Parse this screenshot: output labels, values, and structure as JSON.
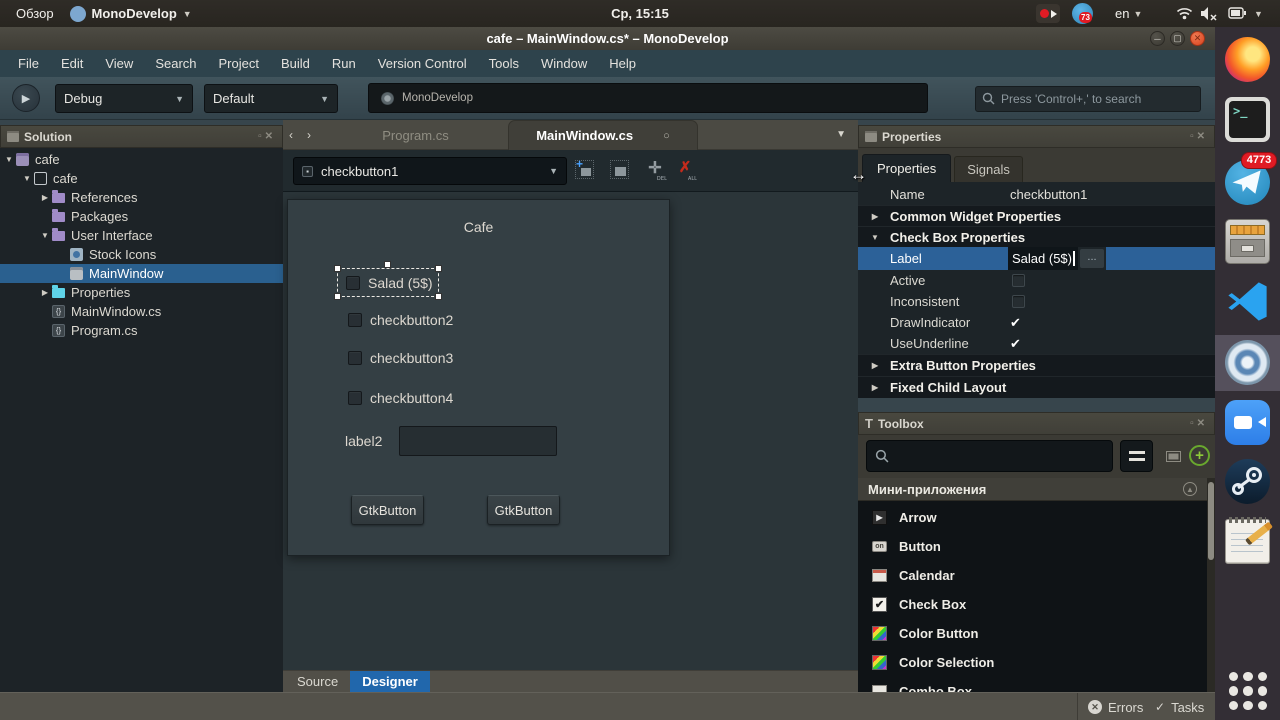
{
  "top_bar": {
    "activities": "Обзор",
    "app_indicator": "MonoDevelop",
    "clock": "Ср, 15:15",
    "language": "en",
    "tray_badge": "73"
  },
  "window": {
    "title": "cafe – MainWindow.cs* – MonoDevelop",
    "menus": [
      "File",
      "Edit",
      "View",
      "Search",
      "Project",
      "Build",
      "Run",
      "Version Control",
      "Tools",
      "Window",
      "Help"
    ],
    "toolbar": {
      "run_config": "Debug",
      "run_target": "Default",
      "status_text": "MonoDevelop",
      "search_placeholder": "Press 'Control+,' to search"
    }
  },
  "solution_pad": {
    "header": "Solution",
    "items": [
      {
        "label": "cafe"
      },
      {
        "label": "cafe"
      },
      {
        "label": "References"
      },
      {
        "label": "Packages"
      },
      {
        "label": "User Interface"
      },
      {
        "label": "Stock Icons"
      },
      {
        "label": "MainWindow"
      },
      {
        "label": "Properties"
      },
      {
        "label": "MainWindow.cs"
      },
      {
        "label": "Program.cs"
      }
    ],
    "cs_glyph": "{}"
  },
  "editor": {
    "tabs": [
      "Program.cs",
      "MainWindow.cs"
    ],
    "widget_selector": "checkbutton1",
    "view_tabs": [
      "Source",
      "Designer"
    ]
  },
  "designer": {
    "window_title": "Cafe",
    "checkboxes": [
      "Salad (5$)",
      "checkbutton2",
      "checkbutton3",
      "checkbutton4"
    ],
    "label2": "label2",
    "entry_value": "",
    "buttons": [
      "GtkButton",
      "GtkButton"
    ]
  },
  "properties_pad": {
    "header": "Properties",
    "tabs": [
      "Properties",
      "Signals"
    ],
    "name_label": "Name",
    "name_value": "checkbutton1",
    "groups": {
      "common": "Common Widget Properties",
      "checkbox": "Check Box Properties",
      "extra": "Extra Button Properties",
      "fixed": "Fixed Child Layout"
    },
    "rows": {
      "label": "Label",
      "label_value": "Salad (5$)",
      "ellipsis": "...",
      "active": "Active",
      "inconsistent": "Inconsistent",
      "draw_indicator": "DrawIndicator",
      "use_underline": "UseUnderline"
    }
  },
  "toolbox_pad": {
    "header": "Toolbox",
    "section": "Мини-приложения",
    "items": [
      "Arrow",
      "Button",
      "Calendar",
      "Check Box",
      "Color Button",
      "Color Selection",
      "Combo Box"
    ]
  },
  "status_bar": {
    "errors": "Errors",
    "tasks": "Tasks"
  },
  "dock": {
    "telegram_badge": "4773",
    "terminal_glyph": ">_",
    "button_icon_glyph": "on"
  },
  "colors": {
    "selection_blue": "#2a608f",
    "designer_tab_blue": "#2167ac",
    "close_button": "#ee5432"
  }
}
